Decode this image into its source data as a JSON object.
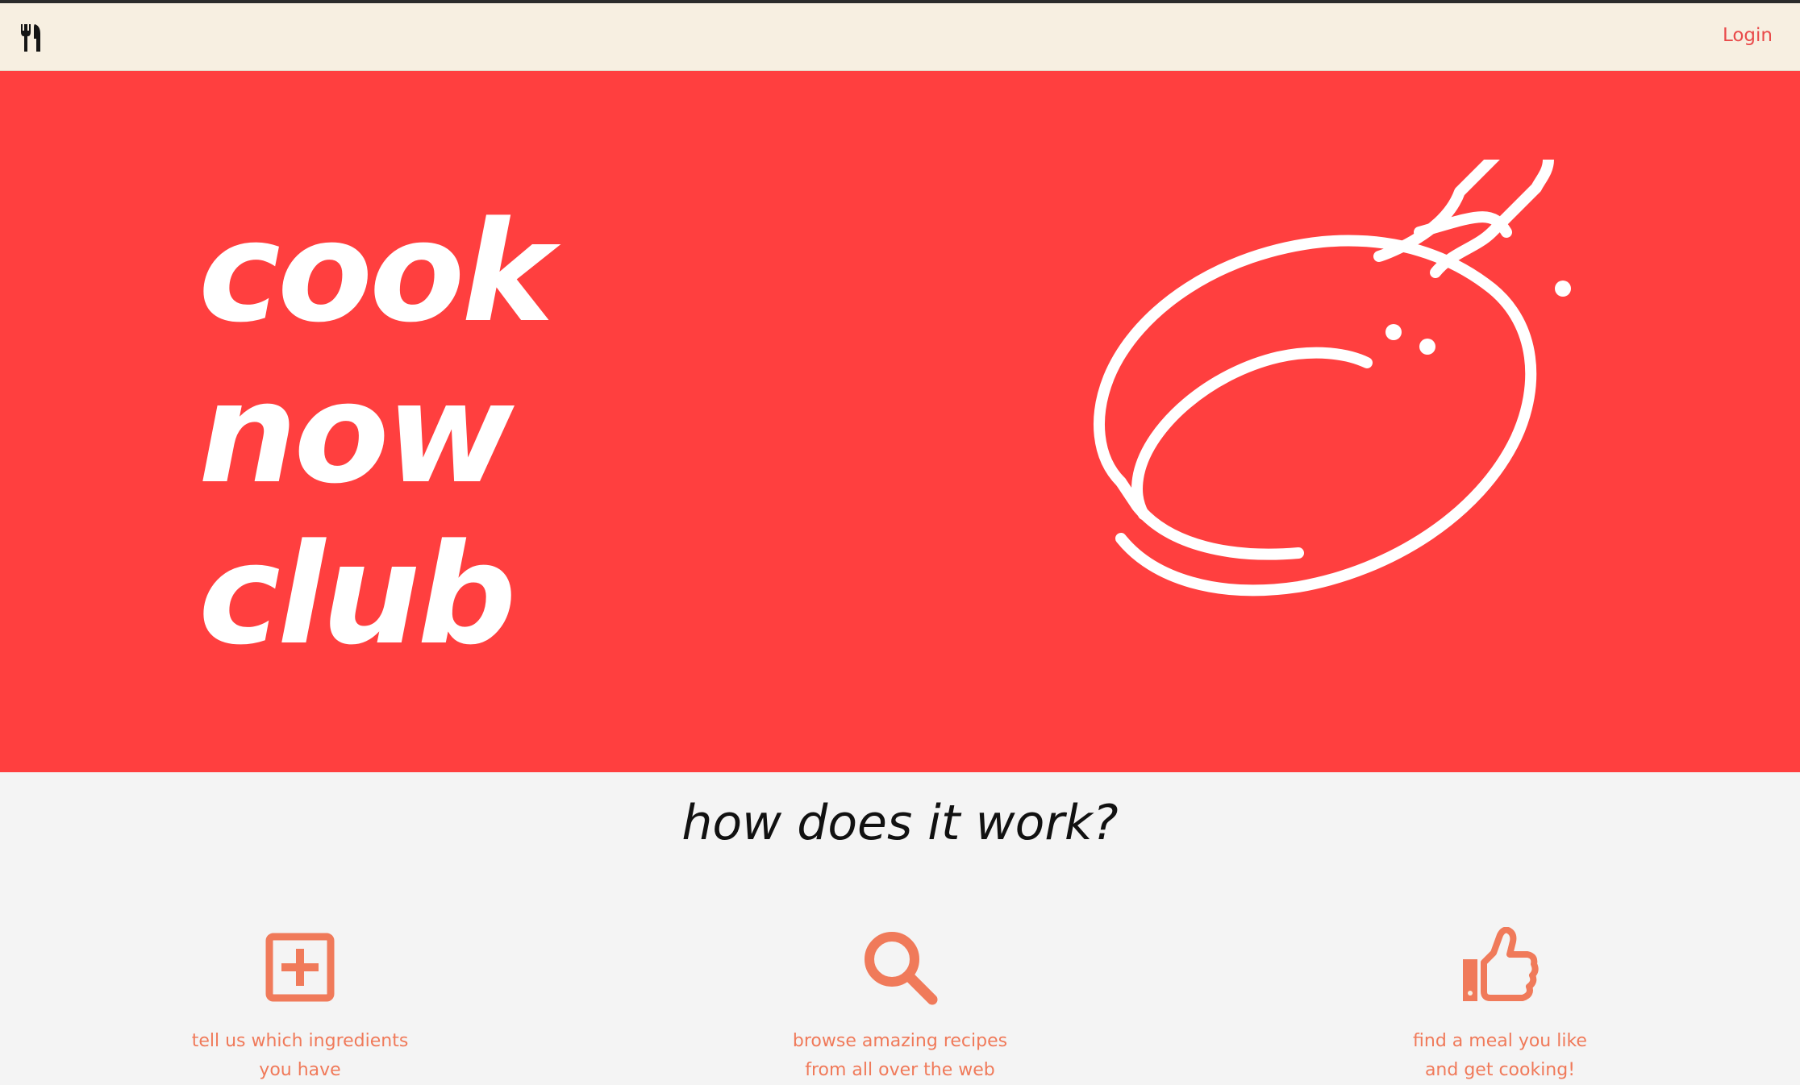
{
  "nav": {
    "brand_icon": "fork-knife-icon",
    "login_label": "Login"
  },
  "hero": {
    "title_lines": [
      "cook",
      "now",
      "club"
    ],
    "illustration": "frying-pan-icon",
    "background_color": "#ff3f3f"
  },
  "how": {
    "title": "how does it work?",
    "steps": [
      {
        "icon": "plus-square-icon",
        "text": "tell us which ingredients\nyou have"
      },
      {
        "icon": "magnifier-icon",
        "text": "browse amazing recipes\nfrom all over the web"
      },
      {
        "icon": "thumbs-up-icon",
        "text": "find a meal you like\nand get cooking!"
      }
    ]
  },
  "colors": {
    "accent": "#f07a5a",
    "nav_background": "#f7efe1",
    "login": "#e94a4a"
  }
}
